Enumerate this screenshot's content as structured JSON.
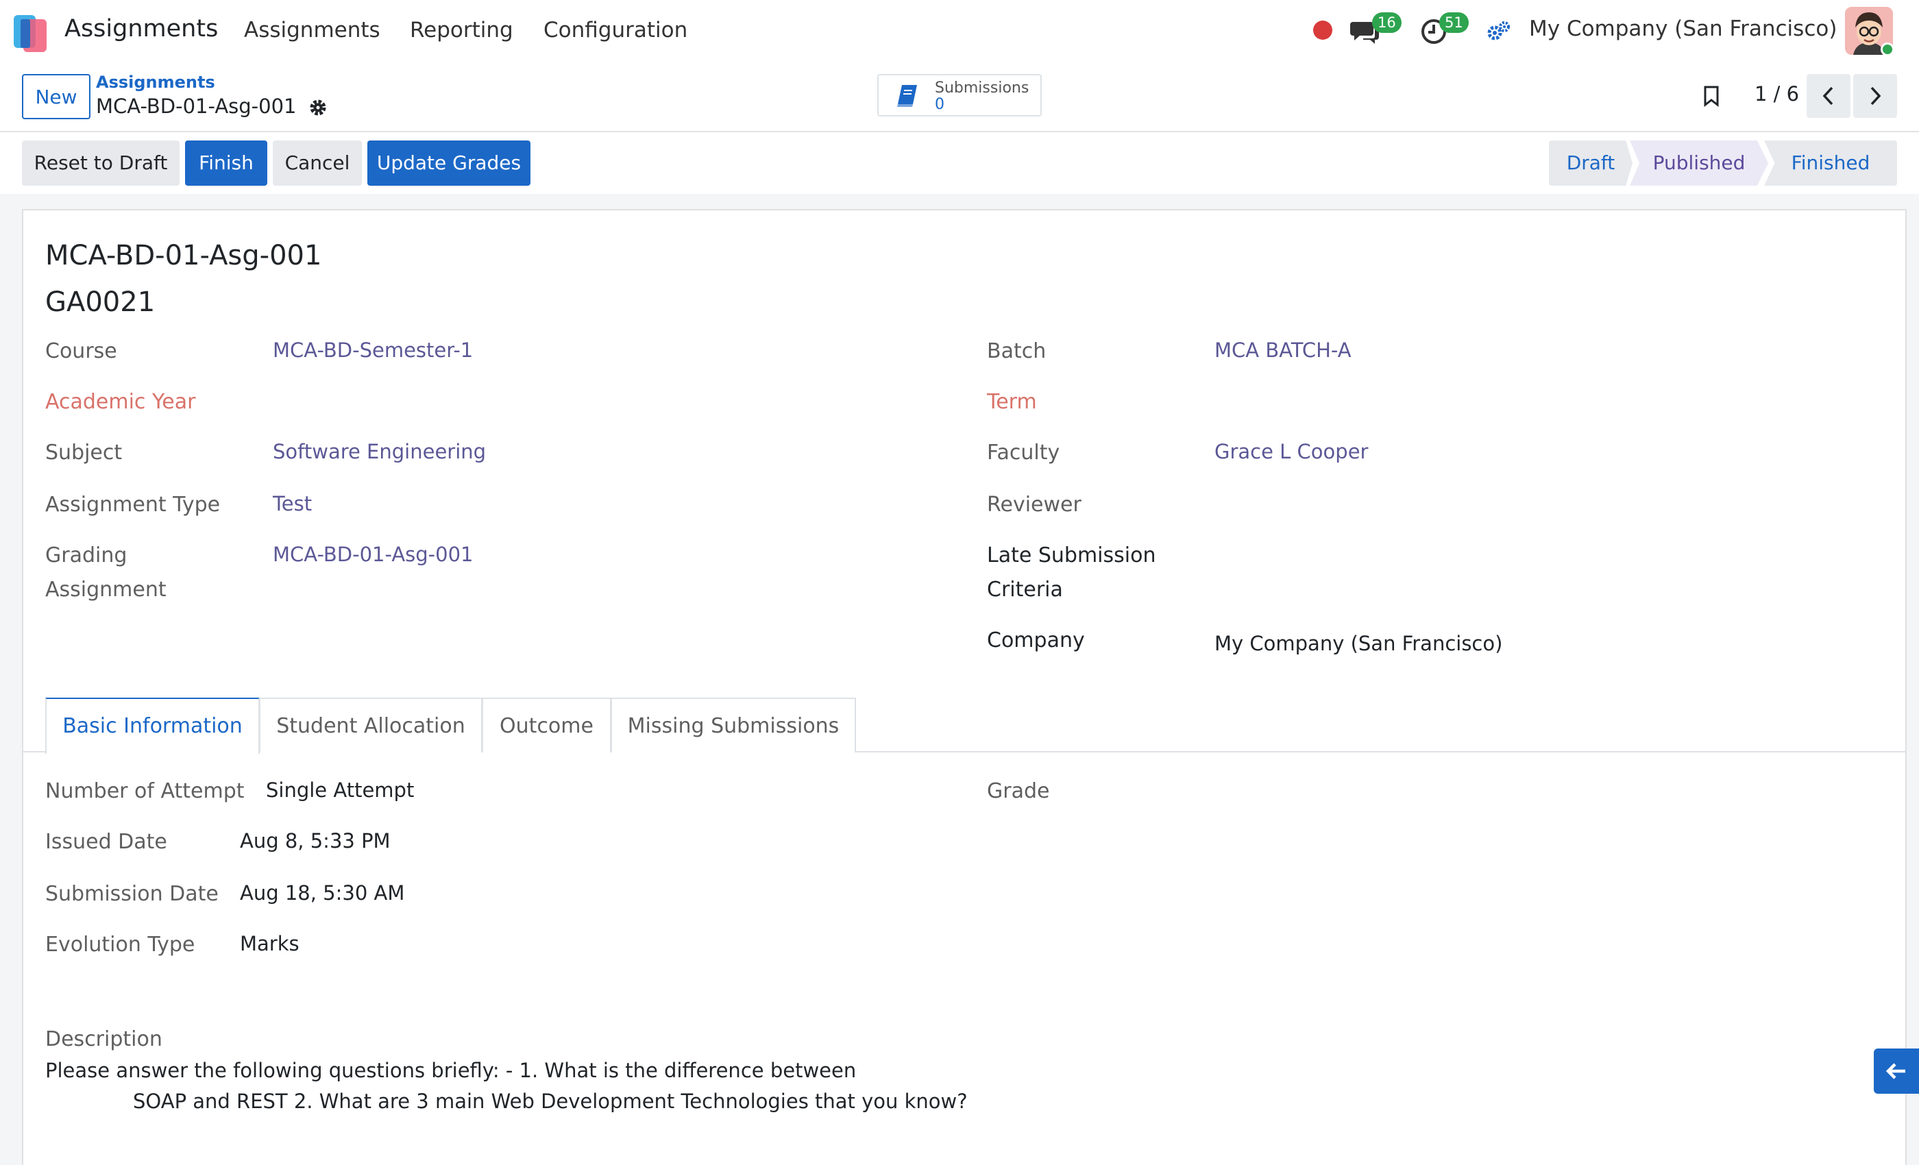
{
  "navbar": {
    "brand": "Assignments",
    "menus": [
      "Assignments",
      "Reporting",
      "Configuration"
    ],
    "chat_count": "16",
    "activity_count": "51",
    "company": "My Company (San Francisco)"
  },
  "control": {
    "new_label": "New",
    "breadcrumb_parent": "Assignments",
    "breadcrumb_current": "MCA-BD-01-Asg-001",
    "smart_button": {
      "label": "Submissions",
      "count": "0"
    },
    "pager": "1 / 6"
  },
  "actions": {
    "reset": "Reset to Draft",
    "finish": "Finish",
    "cancel": "Cancel",
    "update": "Update Grades"
  },
  "stages": [
    "Draft",
    "Published",
    "Finished"
  ],
  "record": {
    "name": "MCA-BD-01-Asg-001",
    "code": "GA0021"
  },
  "fields": {
    "course_label": "Course",
    "course": "MCA-BD-Semester-1",
    "batch_label": "Batch",
    "batch": "MCA BATCH-A",
    "academic_year_label": "Academic Year",
    "term_label": "Term",
    "subject_label": "Subject",
    "subject": "Software Engineering",
    "faculty_label": "Faculty",
    "faculty": "Grace L Cooper",
    "assignment_type_label": "Assignment Type",
    "assignment_type": "Test",
    "reviewer_label": "Reviewer",
    "grading_label_1": "Grading",
    "grading_label_2": "Assignment",
    "grading": "MCA-BD-01-Asg-001",
    "late_label_1": "Late Submission",
    "late_label_2": "Criteria",
    "company_label": "Company",
    "company": "My Company (San Francisco)"
  },
  "tabs": [
    "Basic Information",
    "Student Allocation",
    "Outcome",
    "Missing Submissions"
  ],
  "basic": {
    "attempt_label": "Number of Attempt",
    "attempt": "Single Attempt",
    "grade_label": "Grade",
    "issued_label": "Issued Date",
    "issued": "Aug 8, 5:33 PM",
    "submission_label": "Submission Date",
    "submission": "Aug 18, 5:30 AM",
    "evolution_label": "Evolution Type",
    "evolution": "Marks",
    "description_label": "Description",
    "description_line1": "Please answer the following questions briefly: - 1. What is the difference between",
    "description_line2": "SOAP and REST 2. What are 3 main Web Development Technologies that you know?"
  },
  "colors": {
    "primary": "#1c68c7",
    "link": "#5b5896",
    "required": "#d9726a"
  }
}
